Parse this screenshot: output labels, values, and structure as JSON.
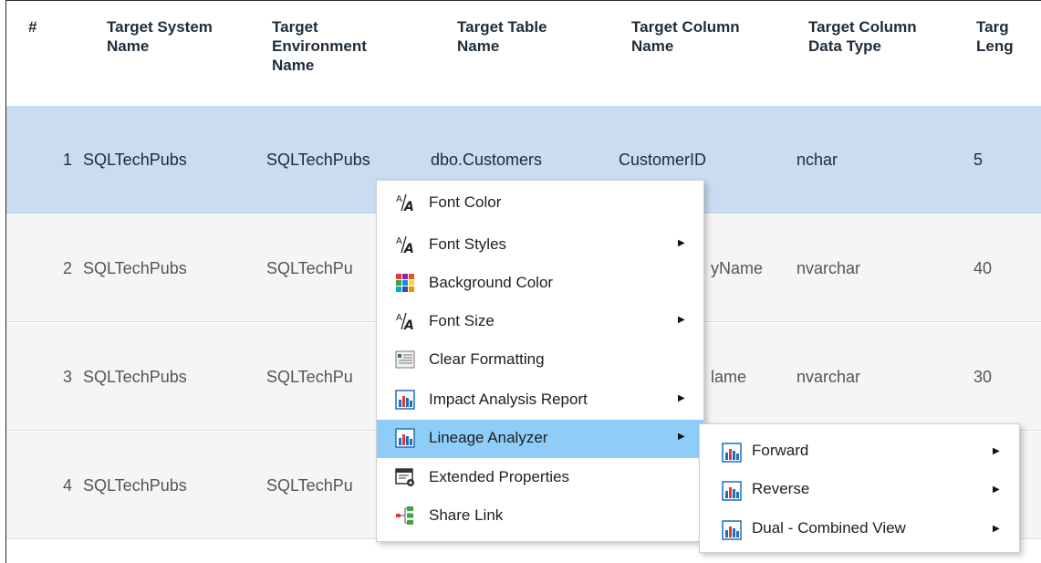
{
  "table": {
    "headers": [
      {
        "id": "num",
        "label": "#"
      },
      {
        "id": "system",
        "label": "Target System\nName"
      },
      {
        "id": "env",
        "label": "Target\nEnvironment\nName"
      },
      {
        "id": "table",
        "label": "Target Table\nName"
      },
      {
        "id": "column",
        "label": "Target Column\nName"
      },
      {
        "id": "dtype",
        "label": "Target Column\nData Type"
      },
      {
        "id": "length",
        "label": "Targ\nLeng"
      }
    ],
    "rows": [
      {
        "num": "1",
        "system": "SQLTechPubs",
        "env": "SQLTechPubs",
        "table": "dbo.Customers",
        "column": "CustomerID",
        "dtype": "nchar",
        "length": "5"
      },
      {
        "num": "2",
        "system": "SQLTechPubs",
        "env": "SQLTechPu",
        "table": "",
        "column": "yName",
        "dtype": "nvarchar",
        "length": "40"
      },
      {
        "num": "3",
        "system": "SQLTechPubs",
        "env": "SQLTechPu",
        "table": "",
        "column": "lame",
        "dtype": "nvarchar",
        "length": "30"
      },
      {
        "num": "4",
        "system": "SQLTechPubs",
        "env": "SQLTechPu",
        "table": "",
        "column": "",
        "dtype": "",
        "length": ""
      }
    ]
  },
  "context_menu": {
    "items": [
      {
        "label": "Font Color",
        "icon": "font-color-icon",
        "submenu": false
      },
      {
        "label": "Font Styles",
        "icon": "font-styles-icon",
        "submenu": true
      },
      {
        "label": "Background Color",
        "icon": "background-color-icon",
        "submenu": false
      },
      {
        "label": "Font Size",
        "icon": "font-size-icon",
        "submenu": true
      },
      {
        "label": "Clear Formatting",
        "icon": "clear-formatting-icon",
        "submenu": false
      },
      {
        "label": "Impact Analysis Report",
        "icon": "report-icon",
        "submenu": true
      },
      {
        "label": "Lineage Analyzer",
        "icon": "report-icon",
        "submenu": true,
        "active": true
      },
      {
        "label": "Extended Properties",
        "icon": "extended-properties-icon",
        "submenu": false
      },
      {
        "label": "Share Link",
        "icon": "share-link-icon",
        "submenu": false
      }
    ],
    "submenu_arrow": "▶"
  },
  "lineage_submenu": {
    "items": [
      {
        "label": "Forward",
        "icon": "report-icon"
      },
      {
        "label": "Reverse",
        "icon": "report-icon"
      },
      {
        "label": "Dual - Combined View",
        "icon": "report-icon"
      }
    ]
  },
  "colors": {
    "selected_row": "#c9dcf2",
    "menu_highlight": "#8ecdf7",
    "accent": "#1f6fb8"
  }
}
